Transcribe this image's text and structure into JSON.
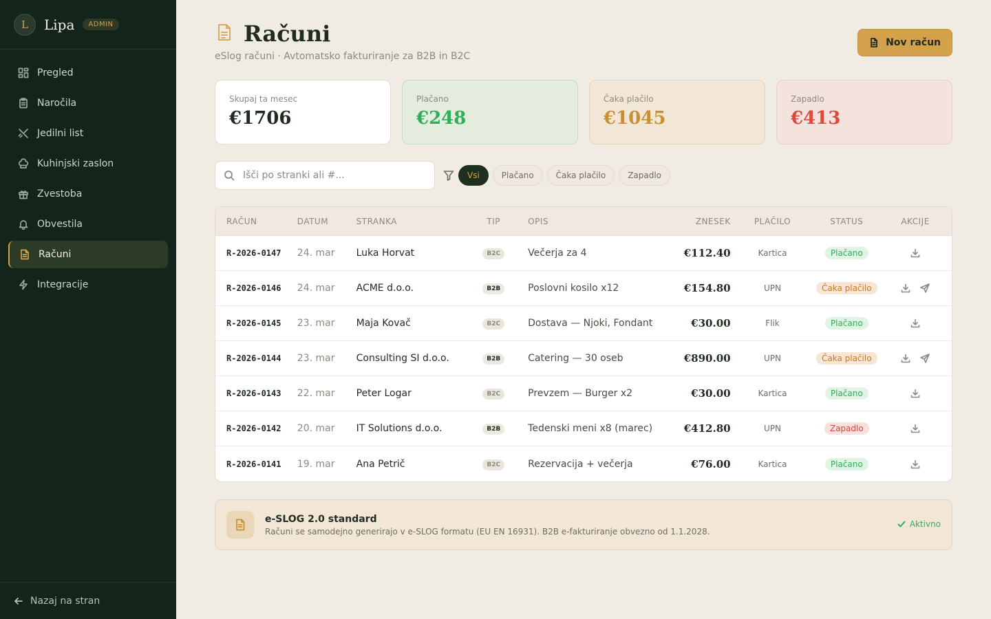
{
  "app": {
    "logo_letter": "L",
    "name": "Lipa",
    "role_badge": "ADMIN"
  },
  "sidebar": {
    "items": [
      {
        "label": "Pregled",
        "icon": "dashboard-icon"
      },
      {
        "label": "Naročila",
        "icon": "clipboard-icon"
      },
      {
        "label": "Jedilni list",
        "icon": "utensils-icon"
      },
      {
        "label": "Kuhinjski zaslon",
        "icon": "chef-hat-icon"
      },
      {
        "label": "Zvestoba",
        "icon": "gift-icon"
      },
      {
        "label": "Obvestila",
        "icon": "bell-icon"
      },
      {
        "label": "Računi",
        "icon": "invoice-icon",
        "active": true
      },
      {
        "label": "Integracije",
        "icon": "lightning-icon"
      }
    ],
    "footer_label": "Nazaj na stran"
  },
  "header": {
    "title": "Računi",
    "subtitle": "eSlog računi · Avtomatsko fakturiranje za B2B in B2C",
    "new_button": "Nov račun"
  },
  "stats": {
    "total": {
      "label": "Skupaj ta mesec",
      "value": "€1706"
    },
    "paid": {
      "label": "Plačano",
      "value": "€248"
    },
    "pending": {
      "label": "Čaka plačilo",
      "value": "€1045"
    },
    "overdue": {
      "label": "Zapadlo",
      "value": "€413"
    }
  },
  "filters": {
    "search_placeholder": "Išči po stranki ali #...",
    "chips": [
      "Vsi",
      "Plačano",
      "Čaka plačilo",
      "Zapadlo"
    ],
    "active_chip": "Vsi"
  },
  "table": {
    "columns": [
      "RAČUN",
      "DATUM",
      "STRANKA",
      "TIP",
      "OPIS",
      "ZNESEK",
      "PLAČILO",
      "STATUS",
      "AKCIJE"
    ],
    "rows": [
      {
        "number": "R-2026-0147",
        "date": "24. mar",
        "client": "Luka Horvat",
        "type": "B2C",
        "description": "Večerja za 4",
        "amount": "€112.40",
        "payment": "Kartica",
        "status": "Plačano",
        "status_kind": "paid",
        "actions": [
          "download"
        ]
      },
      {
        "number": "R-2026-0146",
        "date": "24. mar",
        "client": "ACME d.o.o.",
        "type": "B2B",
        "description": "Poslovni kosilo x12",
        "amount": "€154.80",
        "payment": "UPN",
        "status": "Čaka plačilo",
        "status_kind": "pending",
        "actions": [
          "download",
          "send"
        ]
      },
      {
        "number": "R-2026-0145",
        "date": "23. mar",
        "client": "Maja Kovač",
        "type": "B2C",
        "description": "Dostava — Njoki, Fondant",
        "amount": "€30.00",
        "payment": "Flik",
        "status": "Plačano",
        "status_kind": "paid",
        "actions": [
          "download"
        ]
      },
      {
        "number": "R-2026-0144",
        "date": "23. mar",
        "client": "Consulting SI d.o.o.",
        "type": "B2B",
        "description": "Catering — 30 oseb",
        "amount": "€890.00",
        "payment": "UPN",
        "status": "Čaka plačilo",
        "status_kind": "pending",
        "actions": [
          "download",
          "send"
        ]
      },
      {
        "number": "R-2026-0143",
        "date": "22. mar",
        "client": "Peter Logar",
        "type": "B2C",
        "description": "Prevzem — Burger x2",
        "amount": "€30.00",
        "payment": "Kartica",
        "status": "Plačano",
        "status_kind": "paid",
        "actions": [
          "download"
        ]
      },
      {
        "number": "R-2026-0142",
        "date": "20. mar",
        "client": "IT Solutions d.o.o.",
        "type": "B2B",
        "description": "Tedenski meni x8 (marec)",
        "amount": "€412.80",
        "payment": "UPN",
        "status": "Zapadlo",
        "status_kind": "overdue",
        "actions": [
          "download"
        ]
      },
      {
        "number": "R-2026-0141",
        "date": "19. mar",
        "client": "Ana Petrič",
        "type": "B2C",
        "description": "Rezervacija + večerja",
        "amount": "€76.00",
        "payment": "Kartica",
        "status": "Plačano",
        "status_kind": "paid",
        "actions": [
          "download"
        ]
      }
    ]
  },
  "banner": {
    "title": "e-SLOG 2.0 standard",
    "description": "Računi se samodejno generirajo v e-SLOG formatu (EU EN 16931). B2B e-fakturiranje obvezno od 1.1.2028.",
    "status": "Aktivno"
  },
  "colors": {
    "sidebar_bg": "#13251a",
    "accent": "#d4a24c",
    "paid": "#2fae5a",
    "pending": "#c89034",
    "overdue": "#dd4a3d"
  }
}
